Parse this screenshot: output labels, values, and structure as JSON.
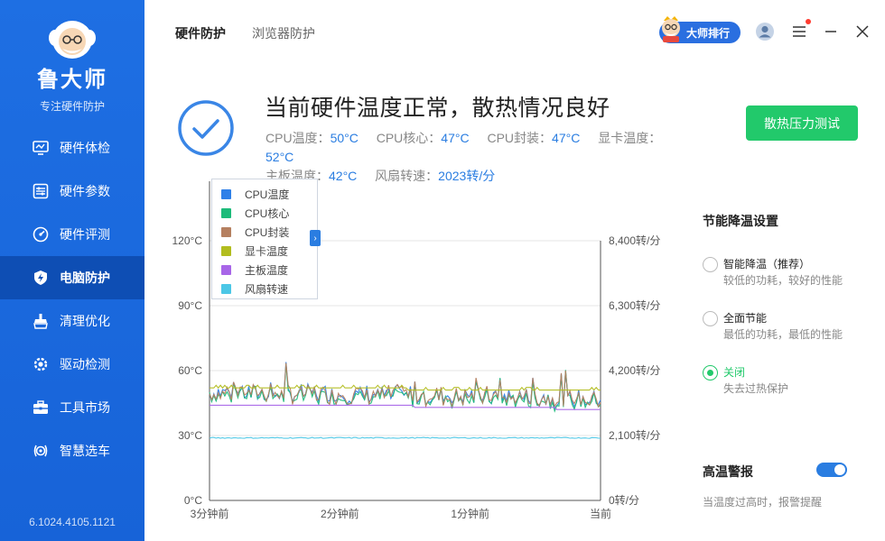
{
  "app": {
    "brand": "鲁大师",
    "slogan": "专注硬件防护",
    "version": "6.1024.4105.1121"
  },
  "sidebar": {
    "items": [
      {
        "label": "硬件体检",
        "icon": "monitor-icon"
      },
      {
        "label": "硬件参数",
        "icon": "parameters-icon"
      },
      {
        "label": "硬件评测",
        "icon": "speedometer-icon"
      },
      {
        "label": "电脑防护",
        "icon": "shield-lightning-icon",
        "active": true
      },
      {
        "label": "清理优化",
        "icon": "broom-icon"
      },
      {
        "label": "驱动检测",
        "icon": "gear-chip-icon"
      },
      {
        "label": "工具市场",
        "icon": "toolbox-icon"
      },
      {
        "label": "智慧选车",
        "icon": "steering-wheel-icon"
      }
    ]
  },
  "header": {
    "tabs": [
      {
        "label": "硬件防护",
        "active": true
      },
      {
        "label": "浏览器防护",
        "active": false
      }
    ],
    "rank_label": "大师排行"
  },
  "status": {
    "title": "当前硬件温度正常，散热情况良好",
    "readings": [
      {
        "label": "CPU温度：",
        "value": "50°C"
      },
      {
        "label": "CPU核心：",
        "value": "47°C"
      },
      {
        "label": "CPU封装：",
        "value": "47°C"
      },
      {
        "label": "显卡温度：",
        "value": "52°C"
      },
      {
        "label": "主板温度：",
        "value": "42°C"
      },
      {
        "label": "风扇转速：",
        "value": "2023转/分"
      }
    ],
    "stress_button": "散热压力测试"
  },
  "colors": {
    "accent": "#2a7de1",
    "green": "#22c96b",
    "sidebar": "#1e6fe3"
  },
  "chart_data": {
    "type": "line",
    "x_ticks": [
      "3分钟前",
      "2分钟前",
      "1分钟前",
      "当前"
    ],
    "y_left_ticks": [
      "0°C",
      "30°C",
      "60°C",
      "90°C",
      "120°C"
    ],
    "y_left_range": [
      0,
      120
    ],
    "y_right_ticks": [
      "0转/分",
      "2,100转/分",
      "4,200转/分",
      "6,300转/分",
      "8,400转/分"
    ],
    "y_right_range": [
      0,
      8400
    ],
    "grid": true,
    "legend_position": "top-left",
    "series": [
      {
        "name": "CPU温度",
        "color": "#2f80e8",
        "base": 50,
        "noise": 4
      },
      {
        "name": "CPU核心",
        "color": "#1dbb7a",
        "base": 49,
        "noise": 4
      },
      {
        "name": "CPU封装",
        "color": "#b58060",
        "base": 50,
        "noise": 4
      },
      {
        "name": "显卡温度",
        "color": "#b2bd1f",
        "base": 52,
        "noise": 1
      },
      {
        "name": "主板温度",
        "color": "#a866e8",
        "base": 44,
        "noise": 0
      },
      {
        "name": "风扇转速",
        "color": "#4cc7e6",
        "base": 2023,
        "noise": 8,
        "axis": "right"
      }
    ]
  },
  "cooling": {
    "title": "节能降温设置",
    "options": [
      {
        "title": "智能降温（推荐）",
        "desc": "较低的功耗，较好的性能",
        "selected": false
      },
      {
        "title": "全面节能",
        "desc": "最低的功耗，最低的性能",
        "selected": false
      },
      {
        "title": "关闭",
        "desc": "失去过热保护",
        "selected": true
      }
    ]
  },
  "alarm": {
    "title": "高温警报",
    "desc": "当温度过高时，报警提醒",
    "enabled": true
  }
}
